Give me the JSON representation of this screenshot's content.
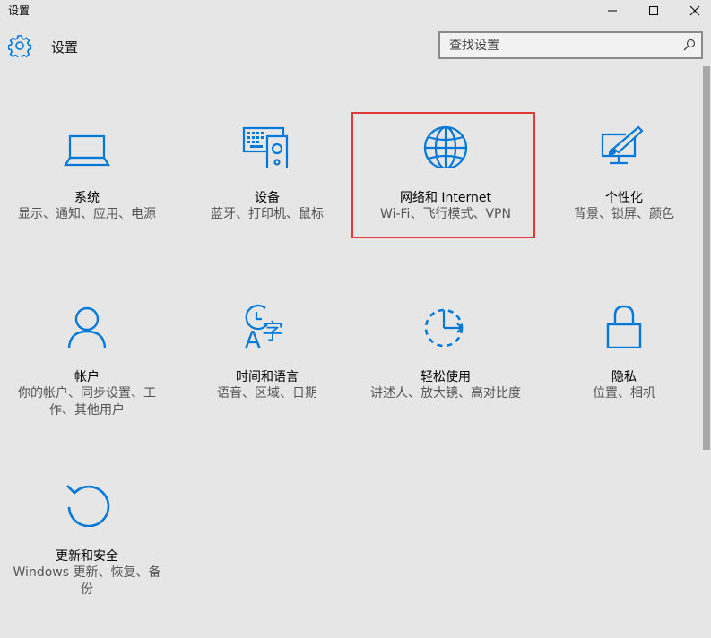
{
  "window": {
    "title": "设置"
  },
  "header": {
    "title": "设置"
  },
  "search": {
    "placeholder": "查找设置"
  },
  "tiles": [
    {
      "name": "系统",
      "desc": "显示、通知、应用、电源",
      "icon": "laptop-icon"
    },
    {
      "name": "设备",
      "desc": "蓝牙、打印机、鼠标",
      "icon": "devices-icon"
    },
    {
      "name": "网络和 Internet",
      "desc": "Wi-Fi、飞行模式、VPN",
      "icon": "globe-icon"
    },
    {
      "name": "个性化",
      "desc": "背景、锁屏、颜色",
      "icon": "personalization-icon"
    },
    {
      "name": "帐户",
      "desc": "你的帐户、同步设置、工作、其他用户",
      "icon": "person-icon"
    },
    {
      "name": "时间和语言",
      "desc": "语音、区域、日期",
      "icon": "time-language-icon"
    },
    {
      "name": "轻松使用",
      "desc": "讲述人、放大镜、高对比度",
      "icon": "ease-of-access-icon"
    },
    {
      "name": "隐私",
      "desc": "位置、相机",
      "icon": "lock-icon"
    },
    {
      "name": "更新和安全",
      "desc": "Windows 更新、恢复、备份",
      "icon": "update-icon"
    }
  ],
  "colors": {
    "accent": "#0078d7",
    "highlight": "#e2393b",
    "background": "#e6e6e6"
  }
}
